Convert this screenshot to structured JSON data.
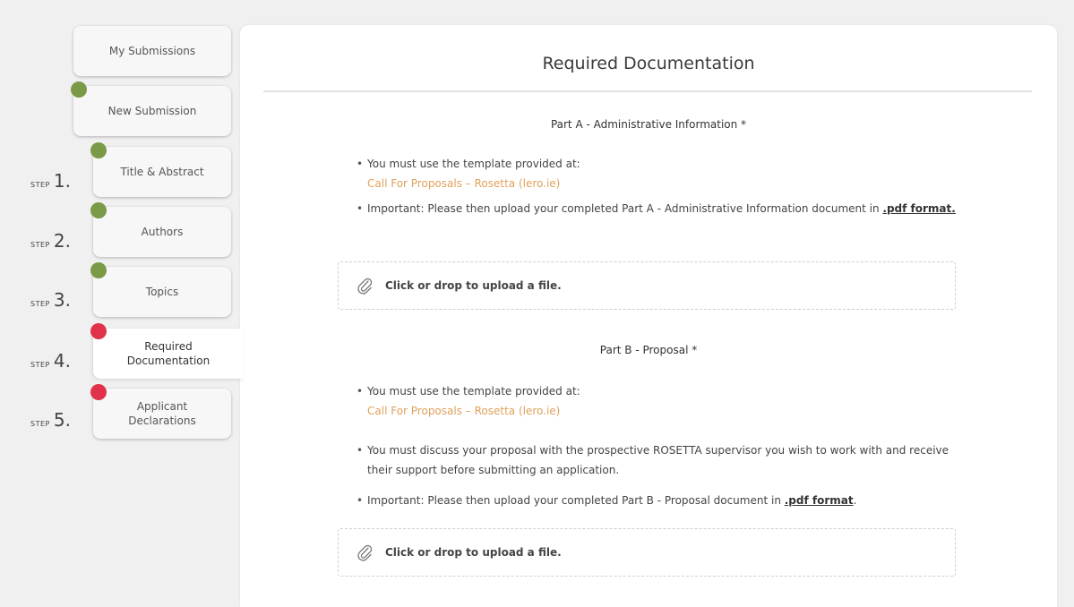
{
  "sidebar": {
    "items": [
      {
        "label": "My Submissions"
      },
      {
        "label": "New Submission"
      },
      {
        "label": "Title & Abstract",
        "step_word": "STEP",
        "step_num": "1."
      },
      {
        "label": "Authors",
        "step_word": "STEP",
        "step_num": "2."
      },
      {
        "label": "Topics",
        "step_word": "STEP",
        "step_num": "3."
      },
      {
        "label": "Required\nDocumentation",
        "step_word": "STEP",
        "step_num": "4."
      },
      {
        "label": "Applicant\nDeclarations",
        "step_word": "STEP",
        "step_num": "5."
      }
    ]
  },
  "colors": {
    "complete": "#7a9a48",
    "incomplete": "#e0334a",
    "link": "#e0a15c"
  },
  "main": {
    "title": "Required Documentation",
    "part_a": {
      "heading": "Part A - Administrative Information *",
      "b1_text": "You must use the template provided at:",
      "b1_link": "Call For Proposals – Rosetta (lero.ie)",
      "b2_text": "Important: Please then upload your completed Part A - Administrative Information document in ",
      "b2_bold": ".pdf format.",
      "upload": "Click or drop to upload a file."
    },
    "part_b": {
      "heading": "Part B - Proposal *",
      "b1_text": "You must use the template provided at:",
      "b1_link": "Call For Proposals – Rosetta (lero.ie)",
      "b2_text": "You must discuss your proposal with the prospective ROSETTA supervisor you wish to work with and receive their support before submitting an application.",
      "b3_text": "Important: Please then upload your completed Part B - Proposal document in ",
      "b3_bold": ".pdf format",
      "b3_tail": ".",
      "upload": "Click or drop to upload a file."
    }
  }
}
